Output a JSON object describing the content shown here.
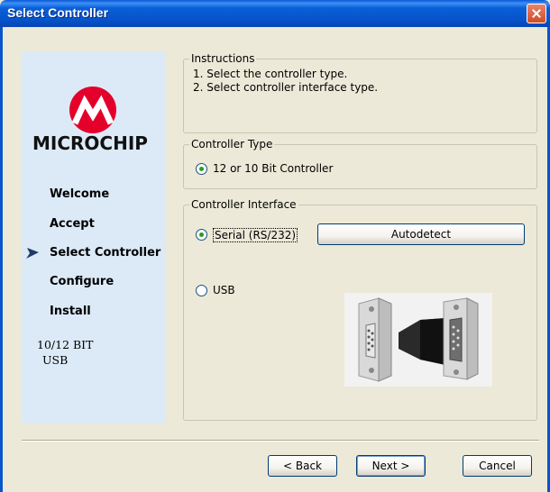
{
  "window": {
    "title": "Select Controller"
  },
  "sidebar": {
    "brand": "MICROCHIP",
    "items": [
      {
        "label": "Welcome",
        "active": false
      },
      {
        "label": "Accept",
        "active": false
      },
      {
        "label": "Select Controller",
        "active": true
      },
      {
        "label": "Configure",
        "active": false
      },
      {
        "label": "Install",
        "active": false
      }
    ],
    "footer_line1": "10/12 BIT",
    "footer_line2": "USB"
  },
  "instructions": {
    "legend": "Instructions",
    "lines": [
      "1. Select the controller type.",
      "2. Select controller interface type."
    ]
  },
  "controller_type": {
    "legend": "Controller Type",
    "option": "12 or 10 Bit Controller",
    "checked": true
  },
  "controller_interface": {
    "legend": "Controller Interface",
    "serial_label": "Serial (RS/232)",
    "serial_checked": true,
    "usb_label": "USB",
    "usb_checked": false,
    "autodetect_label": "Autodetect"
  },
  "footer": {
    "back_label": "< Back",
    "next_label": "Next >",
    "cancel_label": "Cancel"
  },
  "colors": {
    "accent": "#0754CC",
    "close": "#D24A25",
    "sidebar_bg": "#DCEAF7",
    "logo_red": "#E4002B"
  }
}
